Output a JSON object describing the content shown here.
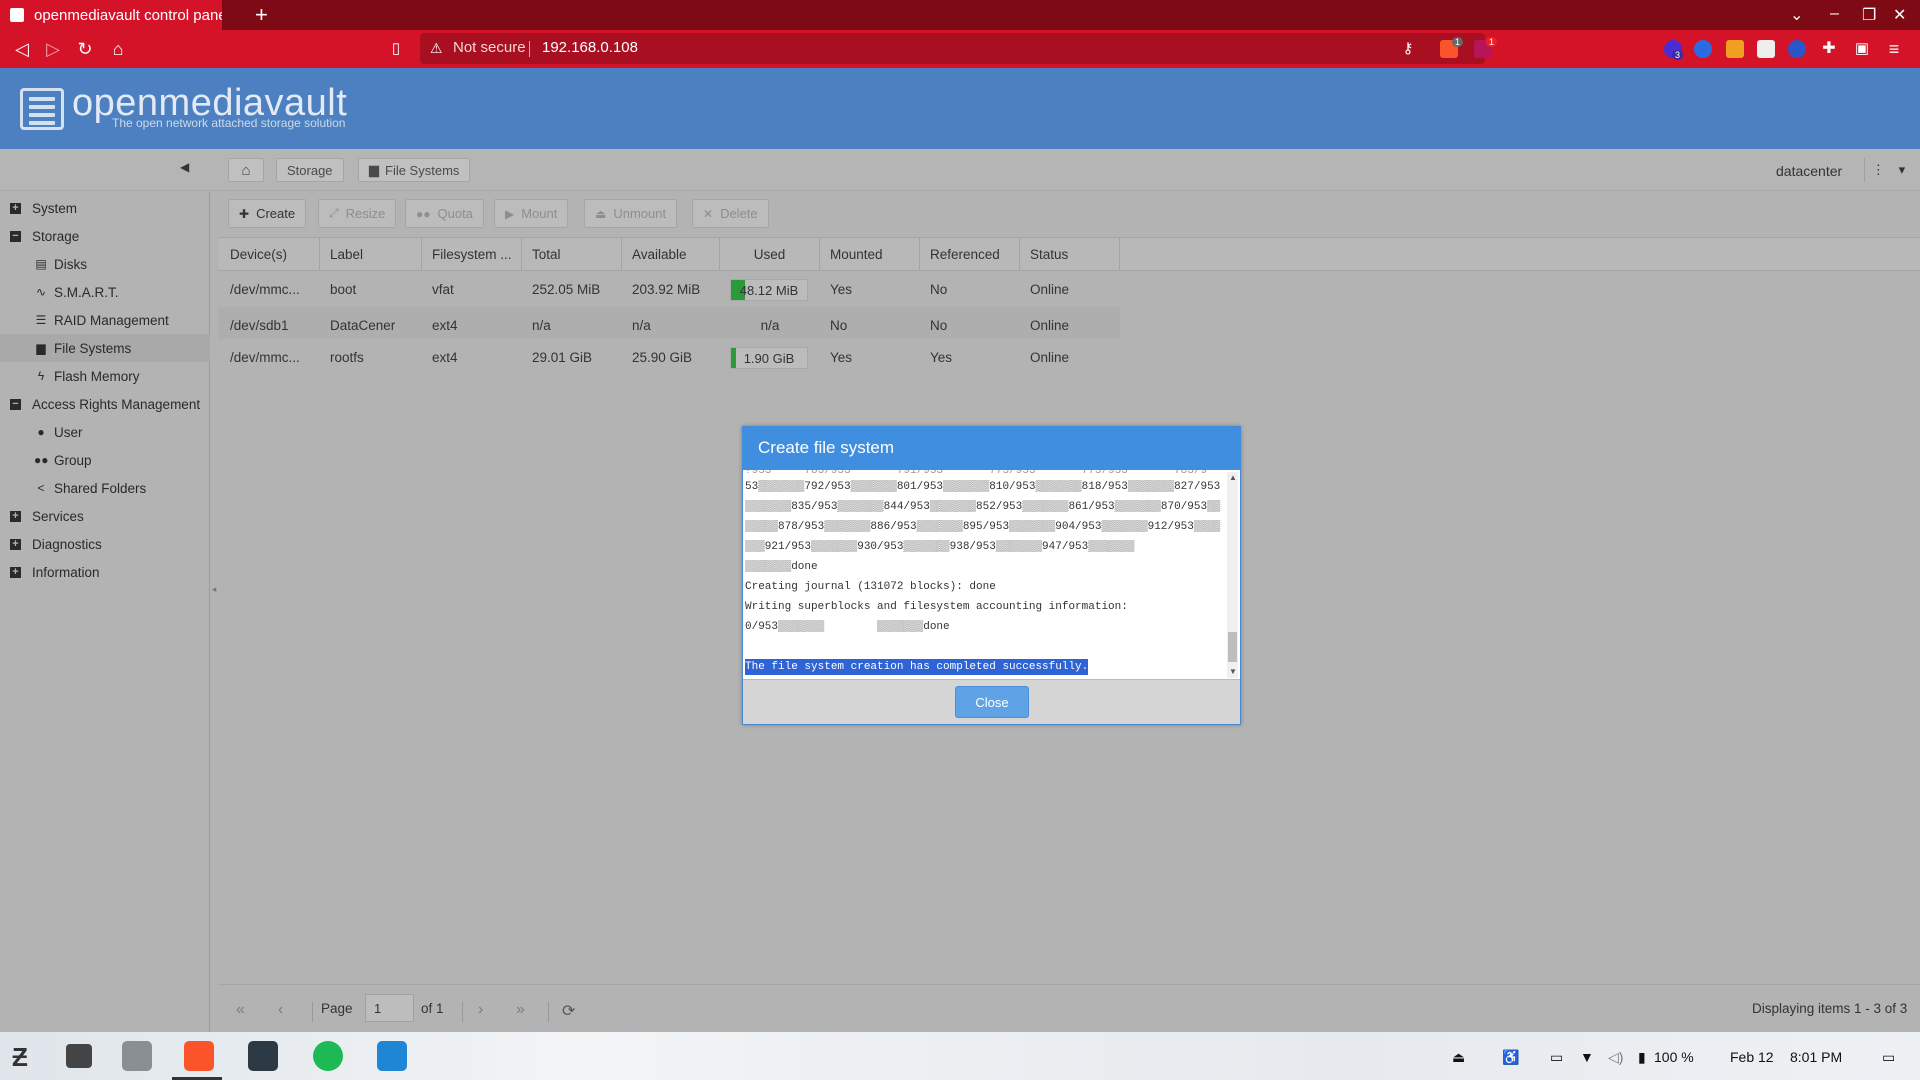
{
  "browser": {
    "tab_title": "openmediavault control panel",
    "address_security": "Not secure",
    "address_url": "192.168.0.108",
    "brave_badge": "1",
    "alert_badge": "1",
    "ext_badge": "3"
  },
  "header": {
    "logo_name": "openmediavault",
    "logo_tagline": "The open network attached storage solution"
  },
  "breadcrumb": {
    "storage": "Storage",
    "filesystems": "File Systems",
    "user": "datacenter"
  },
  "sidebar": {
    "items": [
      {
        "label": "System",
        "expand": "+",
        "level": 0
      },
      {
        "label": "Storage",
        "expand": "−",
        "level": 0
      },
      {
        "label": "Disks",
        "level": 1
      },
      {
        "label": "S.M.A.R.T.",
        "level": 1
      },
      {
        "label": "RAID Management",
        "level": 1
      },
      {
        "label": "File Systems",
        "level": 1
      },
      {
        "label": "Flash Memory",
        "level": 1
      },
      {
        "label": "Access Rights Management",
        "expand": "−",
        "level": 0
      },
      {
        "label": "User",
        "level": 1
      },
      {
        "label": "Group",
        "level": 1
      },
      {
        "label": "Shared Folders",
        "level": 1
      },
      {
        "label": "Services",
        "expand": "+",
        "level": 0
      },
      {
        "label": "Diagnostics",
        "expand": "+",
        "level": 0
      },
      {
        "label": "Information",
        "expand": "+",
        "level": 0
      }
    ]
  },
  "toolbar": {
    "create": "Create",
    "resize": "Resize",
    "quota": "Quota",
    "mount": "Mount",
    "unmount": "Unmount",
    "delete": "Delete"
  },
  "table": {
    "headers": [
      "Device(s)",
      "Label",
      "Filesystem ...",
      "Total",
      "Available",
      "Used",
      "Mounted",
      "Referenced",
      "Status"
    ],
    "rows": [
      {
        "device": "/dev/mmc...",
        "label": "boot",
        "fs": "vfat",
        "total": "252.05 MiB",
        "available": "203.92 MiB",
        "used": "48.12 MiB",
        "used_fraction": 0.19,
        "mounted": "Yes",
        "referenced": "No",
        "status": "Online"
      },
      {
        "device": "/dev/sdb1",
        "label": "DataCener",
        "fs": "ext4",
        "total": "n/a",
        "available": "n/a",
        "used": "n/a",
        "used_fraction": 0,
        "mounted": "No",
        "referenced": "No",
        "status": "Online"
      },
      {
        "device": "/dev/mmc...",
        "label": "rootfs",
        "fs": "ext4",
        "total": "29.01 GiB",
        "available": "25.90 GiB",
        "used": "1.90 GiB",
        "used_fraction": 0.07,
        "mounted": "Yes",
        "referenced": "Yes",
        "status": "Online"
      }
    ]
  },
  "pager": {
    "page_label": "Page",
    "page_value": "1",
    "of_label": "of 1",
    "display": "Displaying items 1 - 3 of 3"
  },
  "dialog": {
    "title": "Create file system",
    "log_lines": [
      "53▒▒▒▒▒▒▒792/953▒▒▒▒▒▒▒801/953▒▒▒▒▒▒▒810/953▒▒▒▒▒▒▒818/953▒▒▒▒▒▒▒827/953",
      "▒▒▒▒▒▒▒835/953▒▒▒▒▒▒▒844/953▒▒▒▒▒▒▒852/953▒▒▒▒▒▒▒861/953▒▒▒▒▒▒▒870/953▒▒",
      "▒▒▒▒▒878/953▒▒▒▒▒▒▒886/953▒▒▒▒▒▒▒895/953▒▒▒▒▒▒▒904/953▒▒▒▒▒▒▒912/953▒▒▒▒",
      "▒▒▒921/953▒▒▒▒▒▒▒930/953▒▒▒▒▒▒▒938/953▒▒▒▒▒▒▒947/953▒▒▒▒▒▒▒",
      "▒▒▒▒▒▒▒done",
      "Creating journal (131072 blocks): done",
      "Writing superblocks and filesystem accounting information:",
      "0/953▒▒▒▒▒▒▒        ▒▒▒▒▒▒▒done",
      "",
      "The file system creation has completed successfully."
    ],
    "close_label": "Close"
  },
  "taskbar": {
    "battery": "100 %",
    "date": "Feb 12",
    "time": "8:01 PM"
  },
  "colors": {
    "browser_red": "#d41329",
    "omv_blue": "#4c80c0",
    "dialog_blue": "#3f8ee0",
    "used_green": "#2a9a3a"
  }
}
